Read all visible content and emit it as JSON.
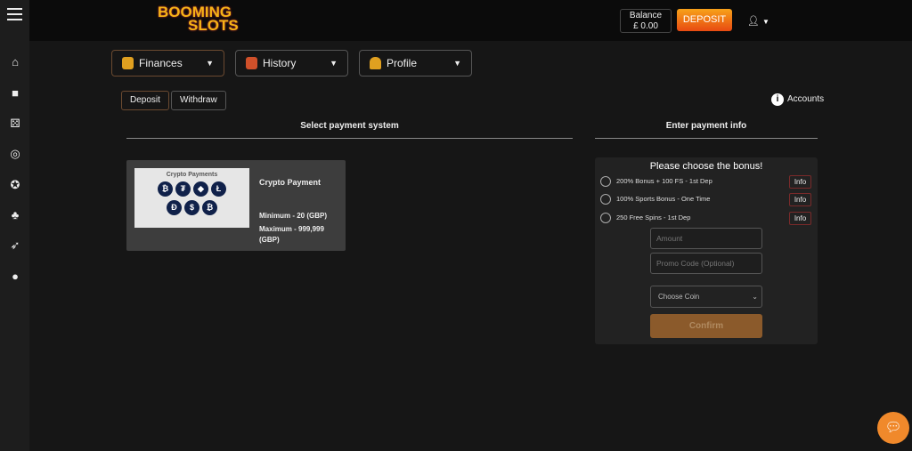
{
  "header": {
    "logo": [
      "BOOMING",
      "SLOTS"
    ],
    "balance_label": "Balance",
    "balance_value": "£ 0.00",
    "deposit": "DEPOSIT"
  },
  "sidebar": {
    "icons": [
      "home-icon",
      "gift-icon",
      "dice-icon",
      "target-icon",
      "poker-chip-icon",
      "clubs-icon",
      "rocket-icon",
      "chat-icon"
    ]
  },
  "menus": [
    {
      "label": "Finances"
    },
    {
      "label": "History"
    },
    {
      "label": "Profile"
    }
  ],
  "tabs": [
    {
      "label": "Deposit"
    },
    {
      "label": "Withdraw"
    }
  ],
  "accounts": "Accounts",
  "sections": {
    "left": "Select payment system",
    "right": "Enter payment info"
  },
  "card": {
    "image_title": "Crypto Payments",
    "coins": [
      "₿",
      "₮",
      "◆",
      "Ł",
      "Ð",
      "$",
      "₿"
    ],
    "name": "Crypto Payment",
    "min": "Minimum - 20 (GBP)",
    "max": "Maximum - 999,999 (GBP)"
  },
  "bonus": {
    "title": "Please choose the bonus!",
    "options": [
      {
        "label": "200% Bonus + 100 FS - 1st Dep",
        "info": "Info"
      },
      {
        "label": "100% Sports Bonus - One Time",
        "info": "Info"
      },
      {
        "label": "250 Free Spins - 1st Dep",
        "info": "Info"
      }
    ],
    "amount_placeholder": "Amount",
    "promo_placeholder": "Promo Code (Optional)",
    "coin_select": "Choose Coin",
    "confirm": "Confirm"
  },
  "colors": {
    "accent": "#f0892b",
    "deposit": "#e84a12"
  }
}
